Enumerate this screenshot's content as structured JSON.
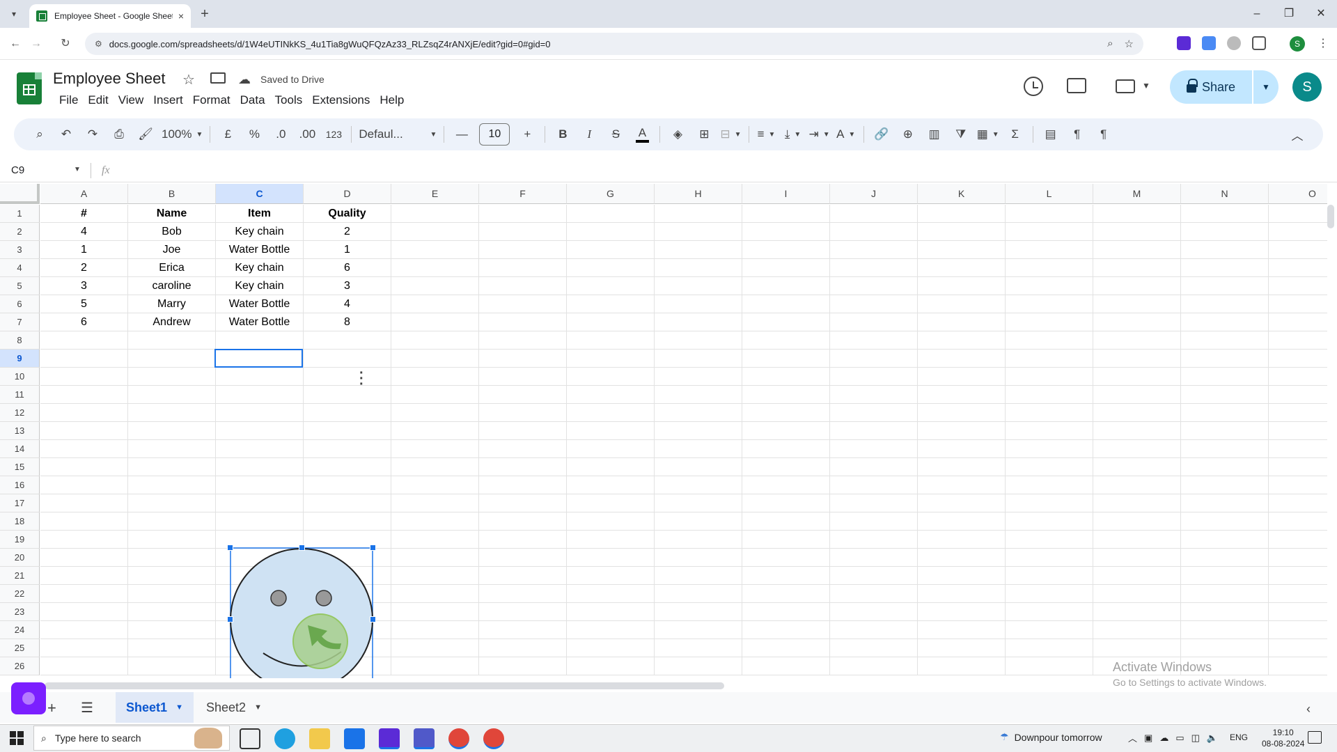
{
  "browser": {
    "tab_title": "Employee Sheet - Google Sheets",
    "url": "docs.google.com/spreadsheets/d/1W4eUTINkKS_4u1Tia8gWuQFQzAz33_RLZsqZ4rANXjE/edit?gid=0#gid=0",
    "new_tab": "+",
    "tab_close": "×",
    "profile_initial": "S",
    "win_min": "–",
    "win_restore": "❐",
    "win_close": "✕"
  },
  "app": {
    "doc_title": "Employee Sheet",
    "save_status": "Saved to Drive",
    "menus": [
      "File",
      "Edit",
      "View",
      "Insert",
      "Format",
      "Data",
      "Tools",
      "Extensions",
      "Help"
    ],
    "share_label": "Share",
    "avatar_initial": "S"
  },
  "toolbar": {
    "zoom": "100%",
    "currency": "£",
    "percent": "%",
    "dec_decrease": ".0",
    "dec_increase": ".00",
    "number_format": "123",
    "font": "Defaul...",
    "font_size": "10",
    "bold": "B",
    "italic": "I",
    "strike": "S",
    "text_color": "A",
    "rotate": "A"
  },
  "formula_bar": {
    "name_box": "C9",
    "fx": "fx"
  },
  "grid": {
    "columns": [
      "A",
      "B",
      "C",
      "D",
      "E",
      "F",
      "G",
      "H",
      "I",
      "J",
      "K",
      "L",
      "M",
      "N",
      "O"
    ],
    "selected_column": "C",
    "rows": [
      "1",
      "2",
      "3",
      "4",
      "5",
      "6",
      "7",
      "8",
      "9",
      "10",
      "11",
      "12",
      "13",
      "14",
      "15",
      "16",
      "17",
      "18",
      "19",
      "20",
      "21",
      "22",
      "23",
      "24",
      "25",
      "26"
    ],
    "selected_row": "9",
    "header": [
      "#",
      "Name",
      "Item",
      "Quality"
    ],
    "data": [
      [
        "4",
        "Bob",
        "Key chain",
        "2"
      ],
      [
        "1",
        "Joe",
        "Water Bottle",
        "1"
      ],
      [
        "2",
        "Erica",
        "Key chain",
        "6"
      ],
      [
        "3",
        "caroline",
        "Key chain",
        "3"
      ],
      [
        "5",
        "Marry",
        "Water Bottle",
        "4"
      ],
      [
        "6",
        "Andrew",
        "Water Bottle",
        "8"
      ]
    ]
  },
  "drawing": {
    "face_fill": "#cfe2f3",
    "nose_fill": "#a8d08d",
    "nose_arrow_color": "#6aa84f",
    "eye_fill": "#999999"
  },
  "sheets": {
    "tabs": [
      "Sheet1",
      "Sheet2"
    ],
    "active": "Sheet1"
  },
  "watermark": {
    "title": "Activate Windows",
    "subtitle": "Go to Settings to activate Windows."
  },
  "taskbar": {
    "search_placeholder": "Type here to search",
    "weather": "Downpour tomorrow",
    "language": "ENG",
    "time": "19:10",
    "date": "08-08-2024"
  }
}
